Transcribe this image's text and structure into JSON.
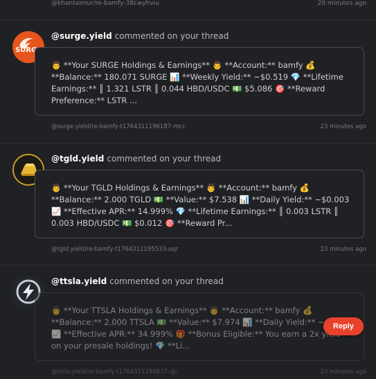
{
  "top_item": {
    "link": "@khantaimur/re-bamfy-38cwyhviu",
    "time": "20 minutes ago"
  },
  "notifications": [
    {
      "user": "@surge.yield",
      "action": "commented on your thread",
      "avatar_label": "SURGE",
      "text": "👨 **Your SURGE Holdings & Earnings** 👨 **Account:** bamfy 💰 **Balance:** 180.071 SURGE 📊 **Weekly Yield:** ~$0.519 💎 **Lifetime Earnings:** ║ 1.321 LSTR ║ 0.044 HBD/USDC 💵 $5.086 🎯 **Reward Preference:** LSTR ...",
      "link": "@surge.yield/re-bamfy-t1764311196187-mcc",
      "time": "23 minutes ago"
    },
    {
      "user": "@tgld.yield",
      "action": "commented on your thread",
      "avatar_label": "",
      "text": "👨 **Your TGLD Holdings & Earnings** 👨 **Account:** bamfy 💰 **Balance:** 2.000 TGLD 💵 **Value:** $7.538 📊 **Daily Yield:** ~$0.003 📈 **Effective APR:** 14.999% 💎 **Lifetime Earnings:** ║ 0.003 LSTR ║ 0.003 HBD/USDC 💵 $0.012 🎯 **Reward Pr...",
      "link": "@tgld.yield/re-bamfy-t1764311195533-uqr",
      "time": "23 minutes ago"
    },
    {
      "user": "@ttsla.yield",
      "action": "commented on your thread",
      "avatar_label": "",
      "text": "👨 **Your TTSLA Holdings & Earnings** 👨 **Account:** bamfy 💰 **Balance:** 2.000 TTSLA 💵 **Value:** $7.974 📊 **Daily Yield:** ~$0.007 📈 **Effective APR:** 34.999% 🎁 **Bonus Eligible:** You earn a 2x yield on your presale holdings! 💎 **Li...",
      "link": "@ttsla.yield/re-bamfy-t1764311194637-qjr",
      "time": "23 minutes ago"
    }
  ],
  "reply_button": {
    "label": "Reply"
  },
  "colors": {
    "background": "#202124",
    "accent": "#e9412c",
    "card_border": "#4a4a4f"
  }
}
